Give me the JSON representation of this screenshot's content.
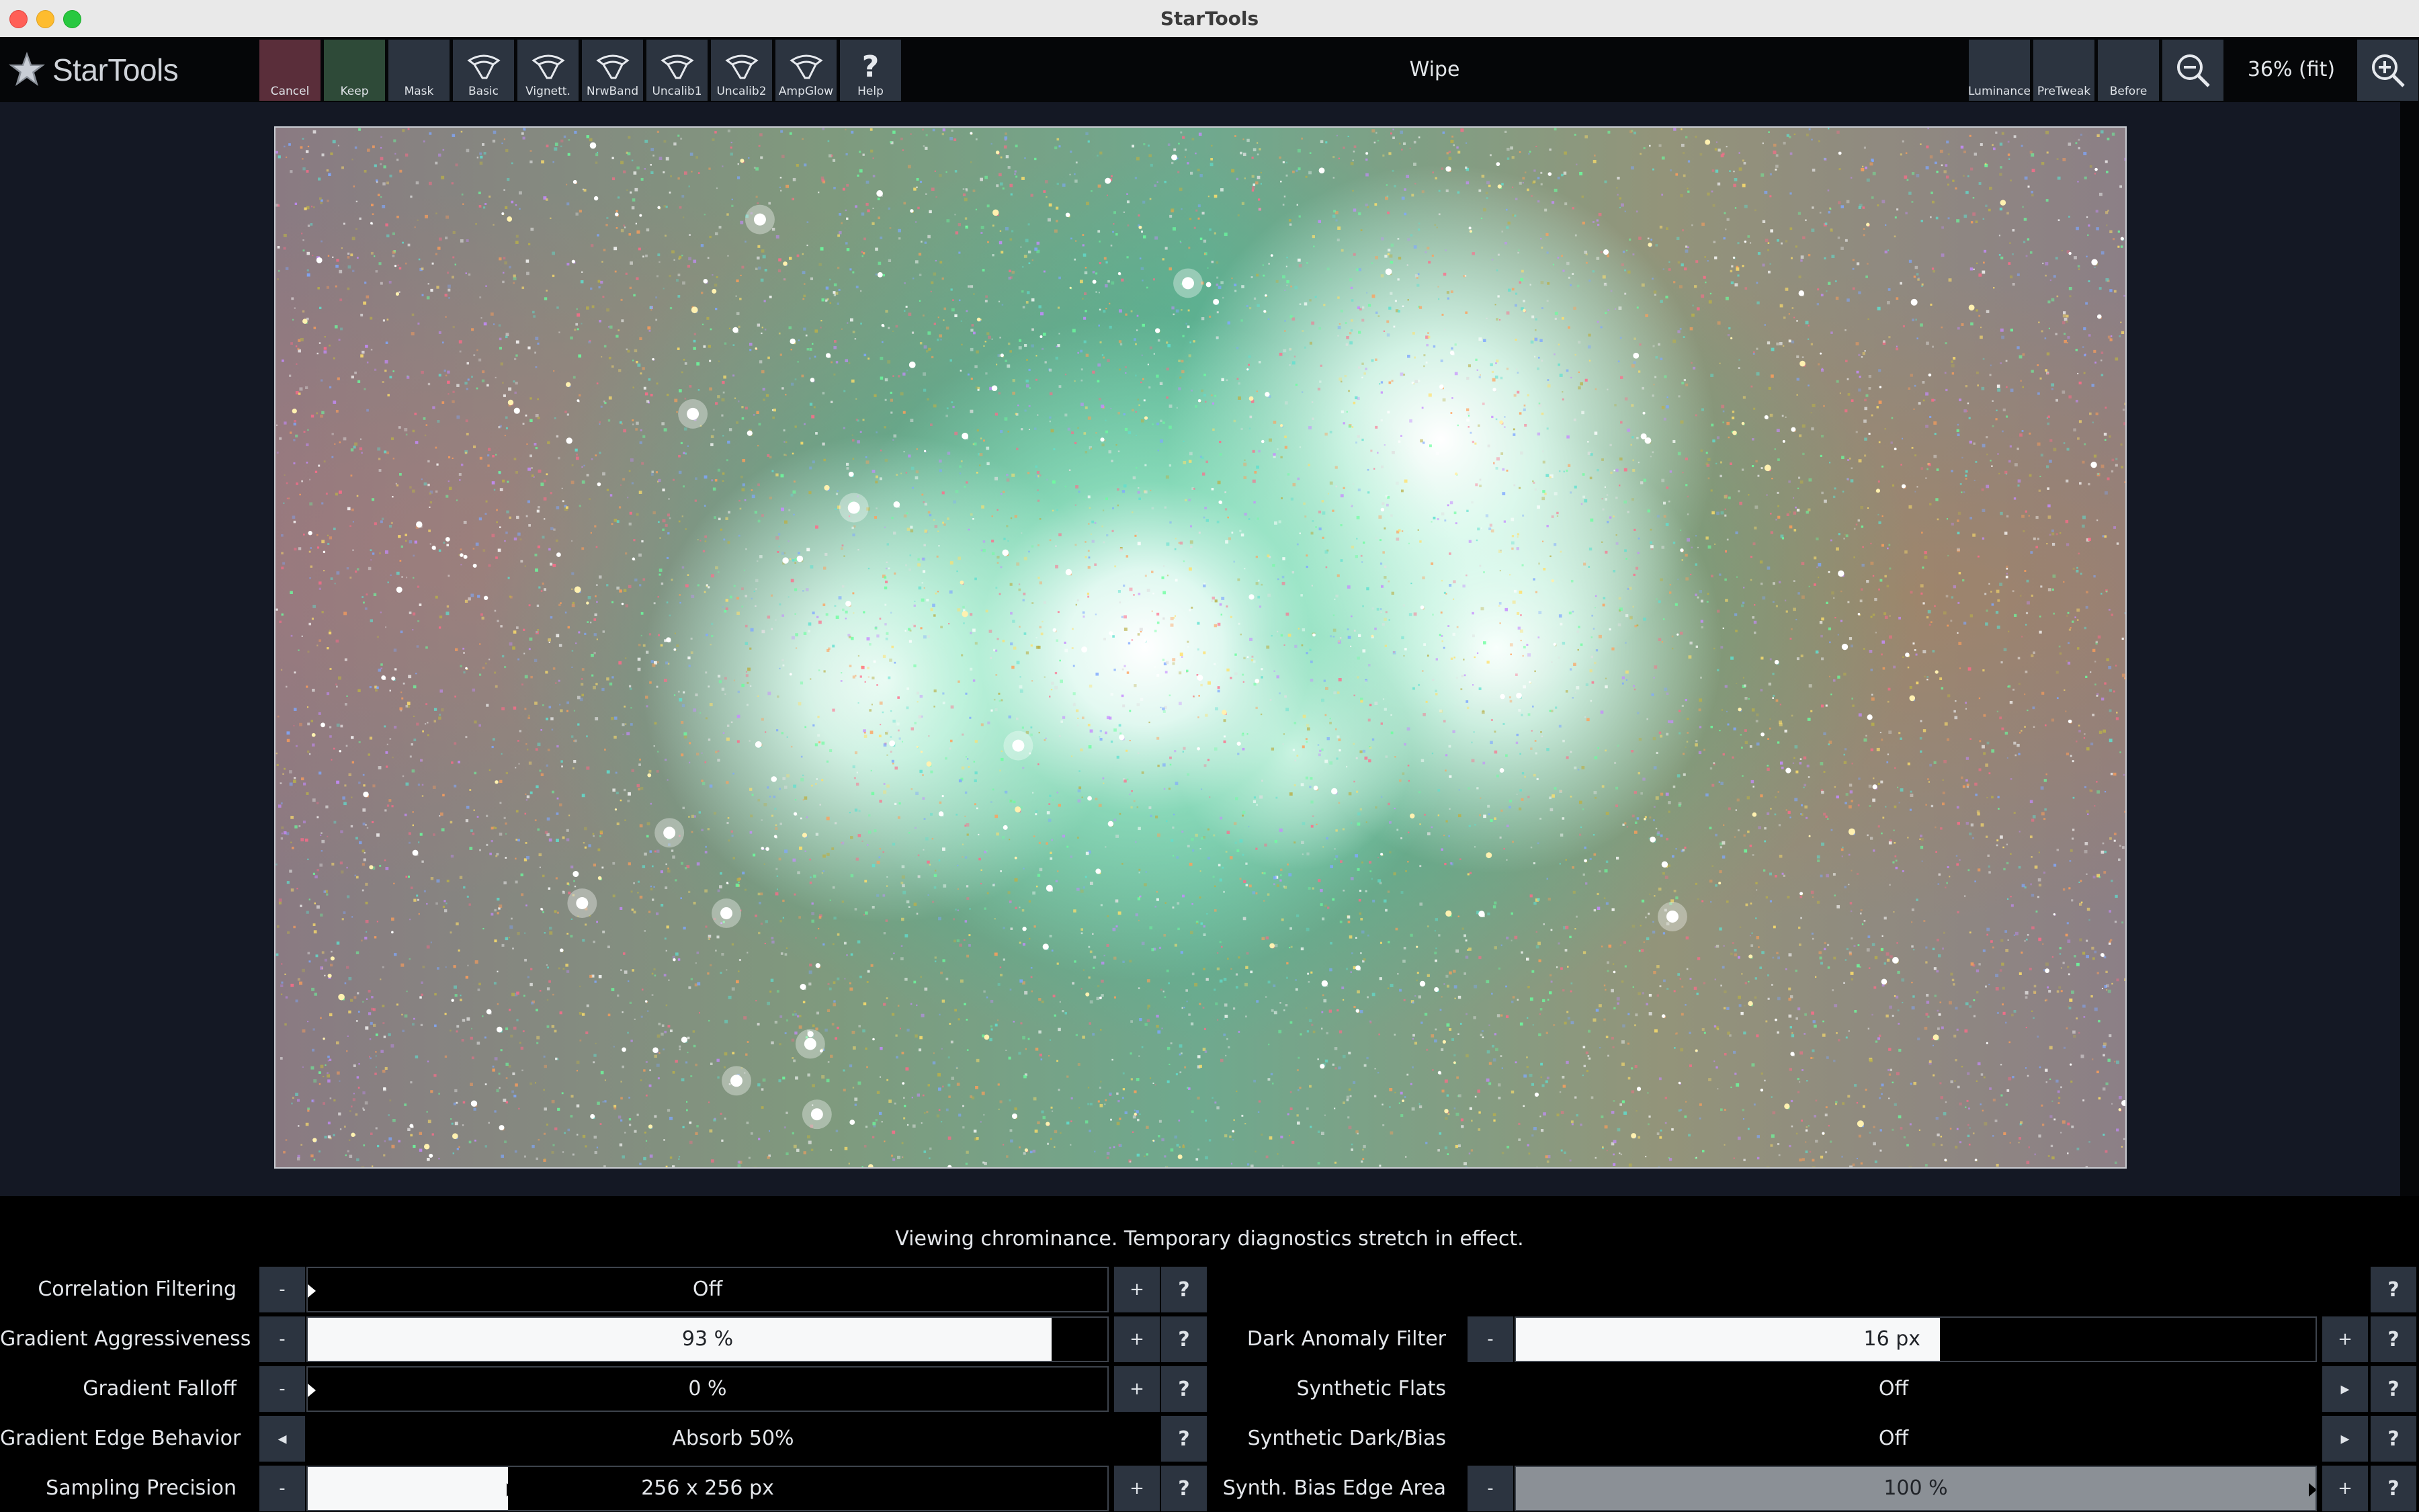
{
  "window": {
    "title": "StarTools"
  },
  "app": {
    "logo_text": "StarTools"
  },
  "toolbar": {
    "buttons": [
      {
        "label": "Cancel",
        "icon": "none",
        "color": "#5a2e3a"
      },
      {
        "label": "Keep",
        "icon": "none",
        "color": "#2e4a38"
      },
      {
        "label": "Mask",
        "icon": "none"
      },
      {
        "label": "Basic",
        "icon": "wipe-preset-icon"
      },
      {
        "label": "Vignett.",
        "icon": "wipe-preset-icon"
      },
      {
        "label": "NrwBand",
        "icon": "wipe-preset-icon"
      },
      {
        "label": "Uncalib1",
        "icon": "wipe-preset-icon"
      },
      {
        "label": "Uncalib2",
        "icon": "wipe-preset-icon"
      },
      {
        "label": "AmpGlow",
        "icon": "wipe-preset-icon"
      },
      {
        "label": "Help",
        "icon": "question-icon"
      }
    ],
    "module_title": "Wipe",
    "right_buttons": [
      {
        "label": "Luminance"
      },
      {
        "label": "PreTweak"
      },
      {
        "label": "Before"
      }
    ],
    "zoom_out_icon": "zoom-out-icon",
    "zoom_label": "36% (fit)",
    "zoom_in_icon": "zoom-in-icon"
  },
  "status_message": "Viewing chrominance. Temporary diagnostics stretch in effect.",
  "left_params": [
    {
      "label": "Correlation Filtering",
      "value": "Off",
      "type": "slider",
      "fill": 0.0
    },
    {
      "label": "Gradient Aggressiveness",
      "value": "93 %",
      "type": "slider",
      "fill": 0.93
    },
    {
      "label": "Gradient Falloff",
      "value": "0 %",
      "type": "slider",
      "fill": 0.0
    },
    {
      "label": "Gradient Edge Behavior",
      "value": "Absorb 50%",
      "type": "option"
    },
    {
      "label": "Sampling Precision",
      "value": "256 x 256 px",
      "type": "slider",
      "fill": 0.25
    }
  ],
  "right_params": [
    {
      "label": "",
      "value": "",
      "type": "empty"
    },
    {
      "label": "Dark Anomaly Filter",
      "value": "16 px",
      "type": "slider",
      "fill": 0.53
    },
    {
      "label": "Synthetic Flats",
      "value": "Off",
      "type": "option"
    },
    {
      "label": "Synthetic Dark/Bias",
      "value": "Off",
      "type": "option"
    },
    {
      "label": "Synth. Bias Edge Area",
      "value": "100 %",
      "type": "slider",
      "fill": 1.0,
      "disabled": true
    }
  ],
  "controls": {
    "minus": "-",
    "plus": "+",
    "help": "?",
    "prev": "◂",
    "next": "▸"
  }
}
